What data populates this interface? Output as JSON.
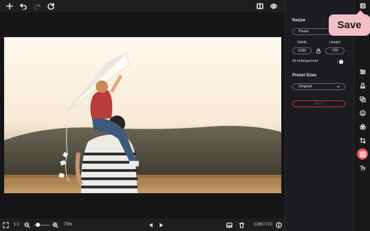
{
  "topbar": {
    "icons": [
      "add-icon",
      "undo-icon",
      "redo-icon",
      "reset-icon",
      "compare-icon",
      "preview-eye-icon",
      "save-icon"
    ]
  },
  "photo": {
    "description_alt": "Father carrying child on shoulders, child holding white kite at sunset"
  },
  "bottombar": {
    "fit_icon": "fit-screen-icon",
    "ratio_label": "1:1",
    "zoom_percent": "75%",
    "zoom_level": 0.25,
    "dimensions": "1280×720"
  },
  "panel": {
    "resize_title": "Resize",
    "unit_select": "Pixels",
    "width_label": "Width",
    "height_label": "Height",
    "width_value": "1280",
    "height_value": "720",
    "ai_label": "AI enlargement",
    "ai_enabled": false,
    "preset_title": "Preset Sizes",
    "preset_select": "Original",
    "apply_label": "Apply"
  },
  "toolbar": {
    "tools": [
      "adjust-icon",
      "stamp-icon",
      "overlay-icon",
      "face-icon",
      "filters-icon",
      "crop-icon",
      "resize-icon",
      "text-icon"
    ],
    "active_tool": "resize-icon"
  },
  "tooltip": {
    "text": "Save"
  },
  "colors": {
    "accent": "#ec5a64",
    "tooltip_bg": "#f3bfc6",
    "panel_bg": "#1c1c20",
    "canvas_bg": "#151518"
  }
}
